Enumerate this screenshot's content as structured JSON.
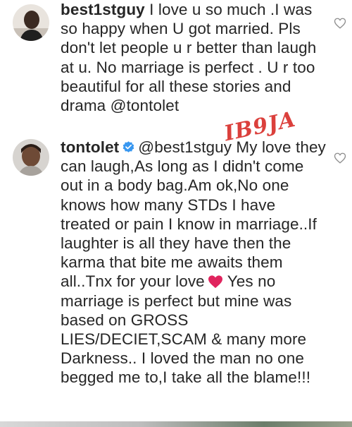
{
  "comments": [
    {
      "username": "best1stguy",
      "text": "I love u so much .I was so happy when U got married. Pls don't let people u r better than laugh at u. No marriage is perfect . U r too beautiful for all these stories and drama",
      "mention": "@tontolet",
      "avatar_icon": "profile-avatar-icon"
    },
    {
      "username": "tontolet",
      "verified": true,
      "mention": "@best1stguy",
      "text_part1": "My love they can laugh,As long as I didn't come out in a body bag.Am ok,No one knows how many STDs I have treated or pain I know in marriage..If laughter is all they have then the karma that bite me awaits them all..Tnx for your love",
      "text_part2": "Yes no marriage is perfect but mine was based on GROSS LIES/DECIET,SCAM & many more Darkness.. I loved the man no one begged me to,I take all the blame!!!",
      "avatar_icon": "profile-avatar-icon"
    }
  ],
  "watermark": "IB9JA",
  "icons": {
    "like": "heart-outline-icon",
    "verified": "verified-badge-icon",
    "emoji": "red-heart-emoji-icon"
  },
  "colors": {
    "text": "#262626",
    "verified": "#3897f0",
    "watermark": "#d9302c",
    "emoji_heart": "#e0245e"
  }
}
